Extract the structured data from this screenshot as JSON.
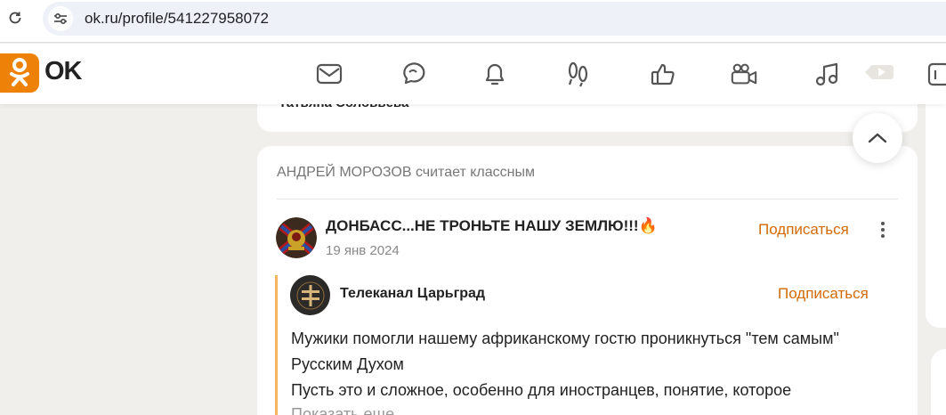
{
  "browser": {
    "url": "ok.ru/profile/541227958072"
  },
  "header": {
    "logo_text": "OK",
    "brand_color": "#ee8208",
    "nav_icons": [
      "mail-icon",
      "chat-icon",
      "bell-icon",
      "guests-icon",
      "like-icon",
      "video-icon",
      "music-icon",
      "video-play-icon",
      "calendar-icon"
    ]
  },
  "feed": {
    "prev_card_author": "Татьяна Соловьева",
    "liker_name": "АНДРЕЙ МОРОЗОВ",
    "liked_action": "считает классным",
    "group_name": "ДОНБАСС...НЕ ТРОНЬТЕ НАШУ ЗЕМЛЮ!!!",
    "group_emoji": "🔥",
    "post_date": "19 янв 2024",
    "subscribe_label": "Подписаться",
    "channel_name": "Телеканал Царьград",
    "channel_subscribe_label": "Подписаться",
    "post_text_lines": [
      "Мужики помогли нашему африканскому гостю проникнуться \"тем самым\"",
      "Русским Духом",
      "Пусть это и сложное, особенно для иностранцев, понятие, которое"
    ],
    "show_more": "Показать еще",
    "accent_color": "#d36b08"
  }
}
